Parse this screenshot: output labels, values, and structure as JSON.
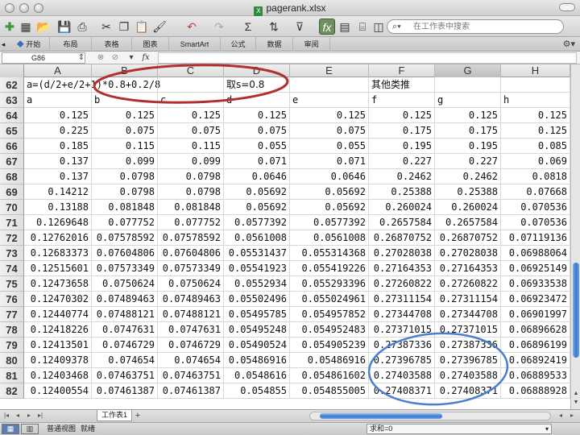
{
  "window": {
    "title": "pagerank.xlsx"
  },
  "toolbar": {
    "search_placeholder": "在工作表中搜索",
    "icons": [
      "new-sheet-icon",
      "new-icon",
      "open-icon",
      "save-icon",
      "print-icon",
      "cut-icon",
      "copy-icon",
      "paste-icon",
      "format-painter-icon",
      "undo-icon",
      "redo-icon",
      "autosum-icon",
      "sort-icon",
      "filter-icon",
      "formula-builder-icon",
      "gallery-icon",
      "toolbox-icon",
      "zoom-icon",
      "help-icon"
    ]
  },
  "ribbon": {
    "tabs": [
      "开始",
      "布局",
      "表格",
      "图表",
      "SmartArt",
      "公式",
      "数据",
      "审阅"
    ]
  },
  "formula_bar": {
    "cell_ref": "G86",
    "fx": "fx"
  },
  "columns": [
    "A",
    "B",
    "C",
    "D",
    "E",
    "F",
    "G",
    "H"
  ],
  "selected_column": "G",
  "rows": [
    {
      "n": "62",
      "cells": [
        "a=(d/2+e/2+1)*0.8+0.2/8",
        "",
        "",
        "取s=0.8",
        "",
        "其他类推",
        "",
        ""
      ]
    },
    {
      "n": "63",
      "cells": [
        "a",
        "b",
        "c",
        "d",
        "e",
        "f",
        "g",
        "h"
      ]
    },
    {
      "n": "64",
      "cells": [
        "0.125",
        "0.125",
        "0.125",
        "0.125",
        "0.125",
        "0.125",
        "0.125",
        "0.125"
      ]
    },
    {
      "n": "65",
      "cells": [
        "0.225",
        "0.075",
        "0.075",
        "0.075",
        "0.075",
        "0.175",
        "0.175",
        "0.125"
      ]
    },
    {
      "n": "66",
      "cells": [
        "0.185",
        "0.115",
        "0.115",
        "0.055",
        "0.055",
        "0.195",
        "0.195",
        "0.085"
      ]
    },
    {
      "n": "67",
      "cells": [
        "0.137",
        "0.099",
        "0.099",
        "0.071",
        "0.071",
        "0.227",
        "0.227",
        "0.069"
      ]
    },
    {
      "n": "68",
      "cells": [
        "0.137",
        "0.0798",
        "0.0798",
        "0.0646",
        "0.0646",
        "0.2462",
        "0.2462",
        "0.0818"
      ]
    },
    {
      "n": "69",
      "cells": [
        "0.14212",
        "0.0798",
        "0.0798",
        "0.05692",
        "0.05692",
        "0.25388",
        "0.25388",
        "0.07668"
      ]
    },
    {
      "n": "70",
      "cells": [
        "0.13188",
        "0.081848",
        "0.081848",
        "0.05692",
        "0.05692",
        "0.260024",
        "0.260024",
        "0.070536"
      ]
    },
    {
      "n": "71",
      "cells": [
        "0.1269648",
        "0.077752",
        "0.077752",
        "0.0577392",
        "0.0577392",
        "0.2657584",
        "0.2657584",
        "0.070536"
      ]
    },
    {
      "n": "72",
      "cells": [
        "0.12762016",
        "0.07578592",
        "0.07578592",
        "0.0561008",
        "0.0561008",
        "0.26870752",
        "0.26870752",
        "0.07119136"
      ]
    },
    {
      "n": "73",
      "cells": [
        "0.12683373",
        "0.07604806",
        "0.07604806",
        "0.05531437",
        "0.055314368",
        "0.27028038",
        "0.27028038",
        "0.06988064"
      ]
    },
    {
      "n": "74",
      "cells": [
        "0.12515601",
        "0.07573349",
        "0.07573349",
        "0.05541923",
        "0.055419226",
        "0.27164353",
        "0.27164353",
        "0.06925149"
      ]
    },
    {
      "n": "75",
      "cells": [
        "0.12473658",
        "0.0750624",
        "0.0750624",
        "0.0552934",
        "0.055293396",
        "0.27260822",
        "0.27260822",
        "0.06933538"
      ]
    },
    {
      "n": "76",
      "cells": [
        "0.12470302",
        "0.07489463",
        "0.07489463",
        "0.05502496",
        "0.055024961",
        "0.27311154",
        "0.27311154",
        "0.06923472"
      ]
    },
    {
      "n": "77",
      "cells": [
        "0.12440774",
        "0.07488121",
        "0.07488121",
        "0.05495785",
        "0.054957852",
        "0.27344708",
        "0.27344708",
        "0.06901997"
      ]
    },
    {
      "n": "78",
      "cells": [
        "0.12418226",
        "0.0747631",
        "0.0747631",
        "0.05495248",
        "0.054952483",
        "0.27371015",
        "0.27371015",
        "0.06896628"
      ]
    },
    {
      "n": "79",
      "cells": [
        "0.12413501",
        "0.0746729",
        "0.0746729",
        "0.05490524",
        "0.054905239",
        "0.27387336",
        "0.27387336",
        "0.06896199"
      ]
    },
    {
      "n": "80",
      "cells": [
        "0.12409378",
        "0.074654",
        "0.074654",
        "0.05486916",
        "0.05486916",
        "0.27396785",
        "0.27396785",
        "0.06892419"
      ]
    },
    {
      "n": "81",
      "cells": [
        "0.12403468",
        "0.07463751",
        "0.07463751",
        "0.0548616",
        "0.054861602",
        "0.27403588",
        "0.27403588",
        "0.06889533"
      ]
    },
    {
      "n": "82",
      "cells": [
        "0.12400554",
        "0.07461387",
        "0.07461387",
        "0.054855",
        "0.054855005",
        "0.27408371",
        "0.27408371",
        "0.06888928"
      ]
    }
  ],
  "sheet_tabs": [
    "工作表1"
  ],
  "status": {
    "view_label": "普通视图",
    "ready": "就绪",
    "sum": "求和=0"
  },
  "annotation_colors": {
    "formula_circle": "#b03030",
    "converge_circle": "#4a7fd0"
  },
  "accent": "#3878d0"
}
